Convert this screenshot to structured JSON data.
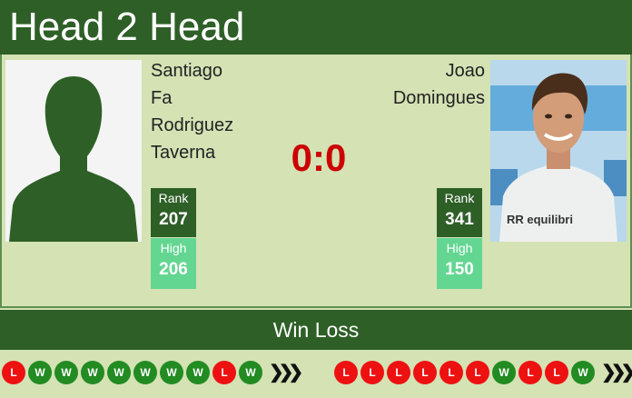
{
  "header": {
    "title": "Head 2 Head"
  },
  "player_left": {
    "name_lines": [
      "Santiago",
      "Fa",
      "Rodriguez",
      "Taverna"
    ],
    "rank_label": "Rank",
    "rank": "207",
    "high_label": "High",
    "high": "206",
    "photo": "silhouette-placeholder"
  },
  "player_right": {
    "name_lines": [
      "Joao",
      "Domingues"
    ],
    "rank_label": "Rank",
    "rank": "341",
    "high_label": "High",
    "high": "150",
    "photo": "player-photo"
  },
  "score": "0:0",
  "winloss": {
    "title": "Win Loss",
    "left_form": [
      "L",
      "W",
      "W",
      "W",
      "W",
      "W",
      "W",
      "W",
      "L",
      "W"
    ],
    "right_form": [
      "L",
      "L",
      "L",
      "L",
      "L",
      "L",
      "W",
      "L",
      "L",
      "W"
    ],
    "more_icon": "chevron-triple-right-icon"
  },
  "colors": {
    "dark_green": "#2e5f27",
    "light_bg": "#d4e2b4",
    "high_green": "#63d692",
    "score_red": "#cc0000",
    "loss_red": "#ee1111",
    "win_green": "#228b22"
  }
}
